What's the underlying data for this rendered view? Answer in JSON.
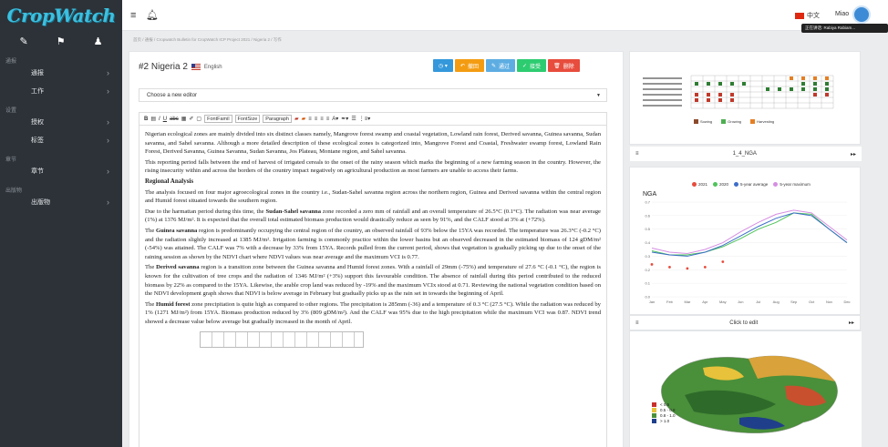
{
  "app": {
    "logo": "CropWatch"
  },
  "sidebar": {
    "sections": [
      {
        "heading": "通报",
        "items": [
          {
            "label": "通报"
          },
          {
            "label": "工作"
          }
        ]
      },
      {
        "heading": "设置",
        "items": [
          {
            "label": "授权"
          },
          {
            "label": "标签"
          }
        ]
      },
      {
        "heading": "章节",
        "items": [
          {
            "label": "章节"
          }
        ]
      },
      {
        "heading": "出版物",
        "items": [
          {
            "label": "出版物"
          }
        ]
      }
    ]
  },
  "topbar": {
    "language": "中文",
    "user": "Miao",
    "tooltip": "正在讲话: Rabiya Rabiam..."
  },
  "breadcrumb": "首页 / 通报 / Cropwatch Bulletin for CropWatch ICP Project 2021 / Nigeria 2 / 写作",
  "editor": {
    "title": "#2 Nigeria 2",
    "language": "English",
    "buttons": [
      {
        "label": "",
        "color": "blue",
        "icon": "clock-icon"
      },
      {
        "label": "撤回",
        "color": "orange",
        "icon": "undo-icon"
      },
      {
        "label": "通过",
        "color": "lblue",
        "icon": "edit-icon"
      },
      {
        "label": "接受",
        "color": "green",
        "icon": "check-icon"
      },
      {
        "label": "删除",
        "color": "red",
        "icon": "trash-icon"
      }
    ],
    "select_placeholder": "Choose a new editor",
    "format": {
      "font_family": "FontFamil",
      "font_size": "FontSize",
      "paragraph": "Paragraph"
    },
    "content": {
      "p1": "Nigerian ecological zones are mainly divided into six distinct classes namely, Mangrove forest swamp and coastal vegetation, Lowland rain forest, Derived savanna, Guinea savanna, Sudan savanna, and Sahel savanna. Although a more detailed description of these ecological zones is categorized into, Mangrove Forest and Coastal, Freshwater swamp forest, Lowland Rain Forest, Derived Savanna, Guinea Savanna, Sudan Savanna, Jos Plateau, Montane region, and Sahel savanna.",
      "p2": "This reporting period falls between the end of harvest of irrigated cereals to the onset of the rainy season which marks the beginning of a new farming season in the country. However, the rising insecurity within and across the borders of the country impact negatively on agricultural production as most farmers are unable to access their farms.",
      "h": "Regional Analysis",
      "p3": "The analysis focused on four major agroecological zones in the country i.e., Sudan-Sahel savanna region across the northern region, Guinea and Derived savanna within the central region and Humid forest situated towards the southern region.",
      "p4a": "Due to the harmattan period during this time, the ",
      "p4b": "Sudan-Sahel savanna",
      "p4c": " zone recorded a zero mm of rainfall and an overall temperature of 26.5°C (0.1°C). The radiation was near average (1%) at 1376 MJ/m². It is expected that the overall total estimated biomass production would drastically reduce as seen by 91%, and the CALF stood at 3% at (+72%).",
      "p5a": "The ",
      "p5b": "Guinea savanna",
      "p5c": " region is predominantly occupying the central region of the country, an observed rainfall of 93% below the 15YA was recorded. The temperature was 26.3°C (-0.2 °C) and the radiation slightly increased at 1385 MJ/m². Irrigation farming is commonly practice within the lower basins but an observed decreased in the estimated biomass of 124 gDM/m² (-54%) was attained. The CALF was 7% with a decrease by 33% from 15YA. Records pulled from the current period, shows that vegetation is gradually picking up due to the onset of the raining session as shown by the NDVI chart where NDVI values was near average and the maximum VCI is 0.77.",
      "p6a": "The ",
      "p6b": "Derived savanna",
      "p6c": " region is a transition zone between the Guinea savanna and Humid forest zones. With a rainfall of 29mm (-75%) and temperature of 27.6 °C (-0.1 °C), the region is known for the cultivation of tree crops and the radiation of 1346 MJ/m² (+3%) support this favourable condition. The absence of rainfall during this period contributed to the reduced biomass by 22% as compared to the 15YA. Likewise, the arable crop land was reduced by -19% and the maximum VCIx stood at 0.71. Reviewing the national vegetation condition based on the NDVI development graph shows that NDVI is below average in February but gradually picks up as the rain set in towards the beginning of April.",
      "p7a": "The ",
      "p7b": "Humid forest",
      "p7c": " zone precipitation is quite high as compared to other regions. The precipitation is 285mm (-36) and a temperature of 0.3 °C (27.5 °C). While the radiation was reduced by 1% (1271 MJ/m²) from 15YA. Biomass production reduced by 3% (809 gDM/m²). And the CALF was 95% due to the high precipitation while the maximum VCI was 0.87. NDVI trend showed a decrease value below average but gradually increased in the month of April."
    }
  },
  "panels": {
    "p1_title": "1_4_NGA",
    "p1_legend": [
      "Sowing",
      "Growing",
      "Harvesting"
    ],
    "p2_title": "Click to edit",
    "chart_title": "NGA"
  },
  "chart_data": {
    "type": "line",
    "title": "NGA",
    "x": [
      "Jan",
      "Feb",
      "Mar",
      "Apr",
      "May",
      "Jun",
      "Jul",
      "Aug",
      "Sep",
      "Oct",
      "Nov",
      "Dec"
    ],
    "ylim": [
      0,
      0.7
    ],
    "series": [
      {
        "name": "2021",
        "values": [
          0.32,
          0.3,
          0.29,
          0.3,
          0.34,
          null,
          null,
          null,
          null,
          null,
          null,
          null
        ],
        "color": "#e74c3c"
      },
      {
        "name": "2020",
        "values": [
          0.34,
          0.31,
          0.31,
          0.33,
          0.37,
          0.43,
          0.5,
          0.55,
          0.62,
          0.61,
          0.5,
          0.4
        ],
        "color": "#4fc35a"
      },
      {
        "name": "5-year average",
        "values": [
          0.33,
          0.31,
          0.3,
          0.33,
          0.38,
          0.45,
          0.52,
          0.58,
          0.62,
          0.6,
          0.5,
          0.4
        ],
        "color": "#3d6ec9"
      },
      {
        "name": "5-year maximum",
        "values": [
          0.36,
          0.33,
          0.32,
          0.35,
          0.4,
          0.48,
          0.55,
          0.61,
          0.64,
          0.62,
          0.52,
          0.42
        ],
        "color": "#d68ee3"
      }
    ]
  },
  "map": {
    "legend": [
      "< 0.5",
      "0.5 - 0.8",
      "0.8 - 1.0",
      "> 1.0"
    ]
  }
}
